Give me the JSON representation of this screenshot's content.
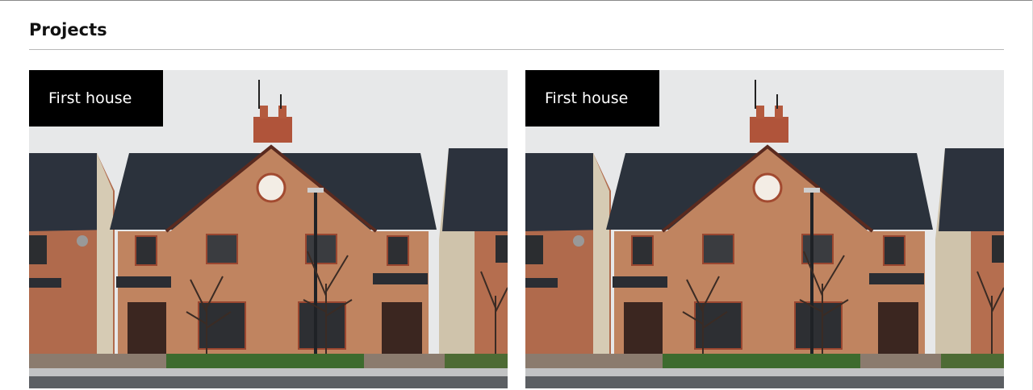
{
  "section": {
    "title": "Projects"
  },
  "projects": [
    {
      "title": "First house",
      "image": "brick-house-photo"
    },
    {
      "title": "First house",
      "image": "brick-house-photo"
    }
  ]
}
